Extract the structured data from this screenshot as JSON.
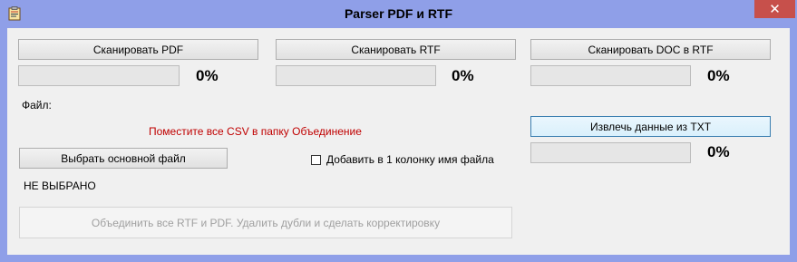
{
  "window": {
    "title": "Parser PDF и RTF",
    "close_glyph": "✕"
  },
  "scan": {
    "pdf": {
      "label": "Сканировать PDF",
      "progress_text": "0%",
      "progress": 0
    },
    "rtf": {
      "label": "Сканировать RTF",
      "progress_text": "0%",
      "progress": 0
    },
    "doc": {
      "label": "Сканировать DOC в RTF",
      "progress_text": "0%",
      "progress": 0
    }
  },
  "file_label": "Файл:",
  "notice": "Поместите все CSV в папку Объединение",
  "extract": {
    "label": "Извлечь данные из TXT",
    "progress_text": "0%",
    "progress": 0
  },
  "choose_main": {
    "label": "Выбрать основной файл"
  },
  "add_filename_checkbox": {
    "label": "Добавить в 1 колонку имя файла",
    "checked": false
  },
  "selection_status": "НЕ ВЫБРАНО",
  "merge": {
    "label": "Объединить все RTF и PDF. Удалить дубли и сделать корректировку",
    "enabled": false
  },
  "colors": {
    "titlebar": "#8f9fe8",
    "close": "#c7504b",
    "notice": "#c00000"
  },
  "icons": {
    "app": "clipboard-icon",
    "close": "close-icon"
  }
}
